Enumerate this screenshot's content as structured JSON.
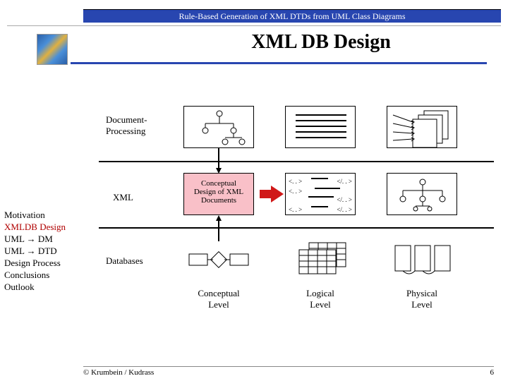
{
  "header": {
    "banner": "Rule-Based Generation of XML DTDs from UML Class Diagrams",
    "title": "XML DB Design"
  },
  "sidebar": {
    "items": [
      {
        "label": "Motivation",
        "active": false
      },
      {
        "label": "XMLDB Design",
        "active": true
      },
      {
        "label": "UML → DM",
        "active": false
      },
      {
        "label": "UML → DTD",
        "active": false
      },
      {
        "label": "Design Process",
        "active": false
      },
      {
        "label": "Conclusions",
        "active": false
      },
      {
        "label": "Outlook",
        "active": false
      }
    ]
  },
  "rows": {
    "doc": "Document-\nProcessing",
    "xml": "XML",
    "db": "Databases"
  },
  "cells": {
    "center": "Conceptual\nDesign of XML\nDocuments",
    "tags": {
      "open": "<. . >",
      "close": "</. . >"
    }
  },
  "columns": {
    "conceptual": "Conceptual\nLevel",
    "logical": "Logical\nLevel",
    "physical": "Physical\nLevel"
  },
  "footer": {
    "copyright": "© Krumbein / Kudrass",
    "page": "6"
  }
}
